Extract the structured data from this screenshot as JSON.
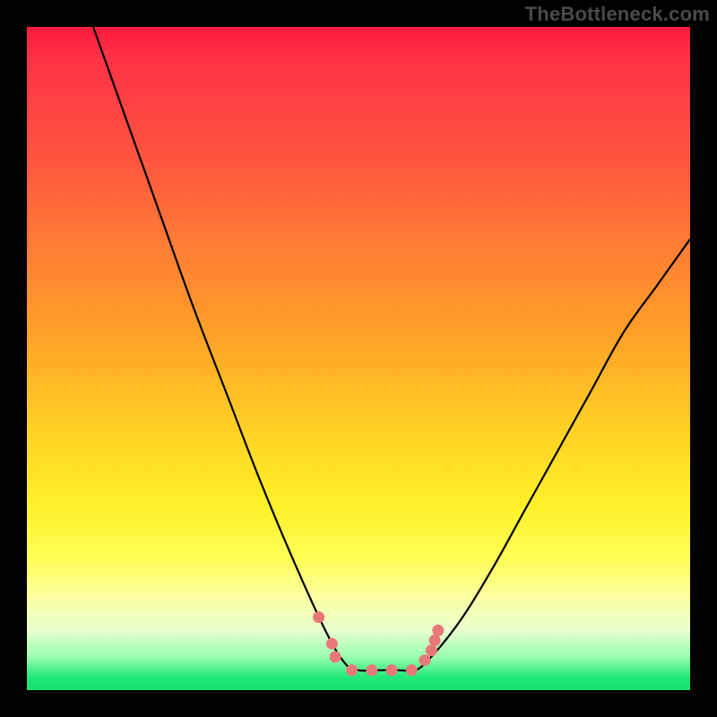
{
  "attribution": "TheBottleneck.com",
  "colors": {
    "frame_border": "#000000",
    "curve": "#000000",
    "marker_fill": "#e87878",
    "marker_stroke": "#c85858"
  },
  "chart_data": {
    "type": "line",
    "title": "",
    "xlabel": "",
    "ylabel": "",
    "xlim": [
      0,
      100
    ],
    "ylim": [
      0,
      100
    ],
    "series": [
      {
        "name": "left-branch",
        "x": [
          10,
          15,
          20,
          25,
          30,
          35,
          40,
          45,
          48
        ],
        "y": [
          100,
          86,
          72,
          58,
          45,
          32,
          20,
          9,
          4
        ]
      },
      {
        "name": "valley-floor",
        "x": [
          48,
          50,
          52,
          54,
          56,
          58,
          60
        ],
        "y": [
          4,
          3,
          3,
          3,
          3,
          3,
          4
        ]
      },
      {
        "name": "right-branch",
        "x": [
          60,
          65,
          70,
          75,
          80,
          85,
          90,
          95,
          100
        ],
        "y": [
          4,
          10,
          18,
          27,
          36,
          45,
          54,
          61,
          68
        ]
      }
    ],
    "markers": [
      {
        "x": 44,
        "y": 11
      },
      {
        "x": 46,
        "y": 7
      },
      {
        "x": 46.5,
        "y": 5
      },
      {
        "x": 49,
        "y": 3
      },
      {
        "x": 52,
        "y": 3
      },
      {
        "x": 55,
        "y": 3
      },
      {
        "x": 58,
        "y": 3
      },
      {
        "x": 60,
        "y": 4.5
      },
      {
        "x": 61,
        "y": 6
      },
      {
        "x": 61.5,
        "y": 7.5
      },
      {
        "x": 62,
        "y": 9
      }
    ]
  }
}
